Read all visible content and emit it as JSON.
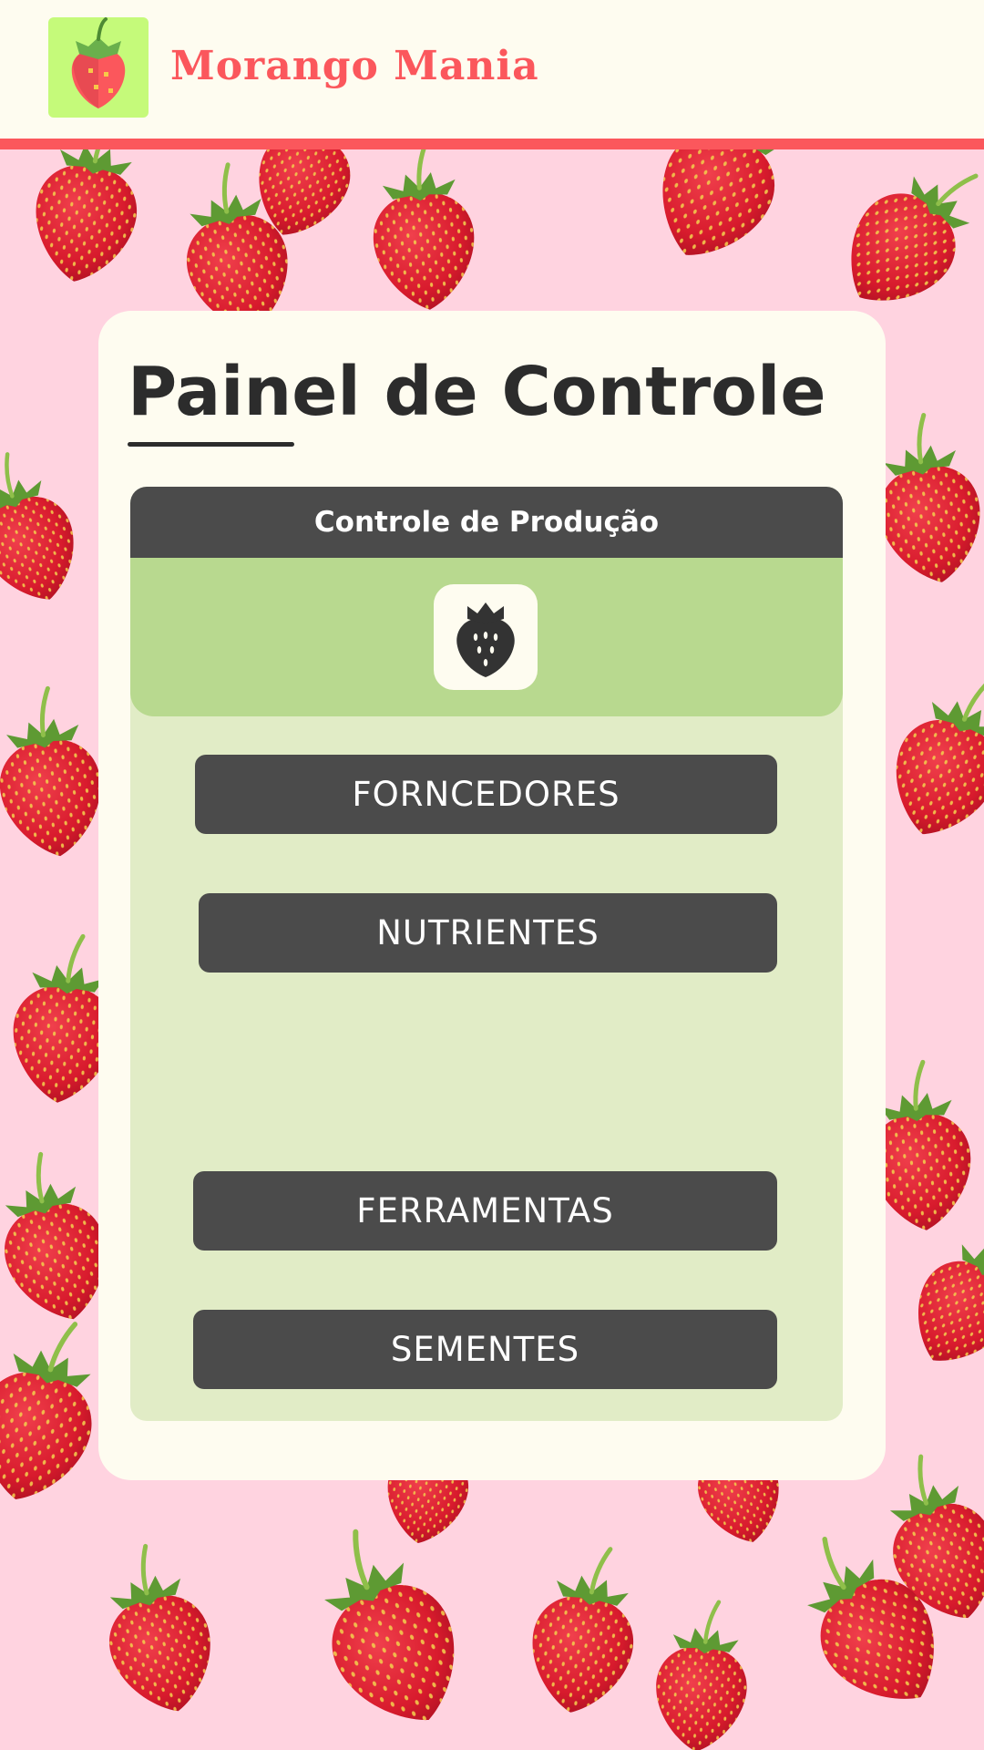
{
  "header": {
    "brand_name": "Morango Mania",
    "logo_icon": "strawberry-logo-icon",
    "background_color": "#fefcf0",
    "accent_color": "#fb575c",
    "logo_tile_color": "#c5fa7a"
  },
  "background": {
    "color": "#ffd3e0",
    "pattern_icon": "strawberry-pattern"
  },
  "card": {
    "title": "Painel de Controle",
    "panel": {
      "header": "Controle de Produção",
      "icon": "strawberry-icon",
      "header_color": "#4b4b4b",
      "band_color": "#b8d98f",
      "body_color": "#e1ecc6"
    },
    "buttons": [
      {
        "label": "FORNCEDORES"
      },
      {
        "label": "NUTRIENTES"
      },
      {
        "label": "FERRAMENTAS"
      },
      {
        "label": "SEMENTES"
      }
    ]
  }
}
